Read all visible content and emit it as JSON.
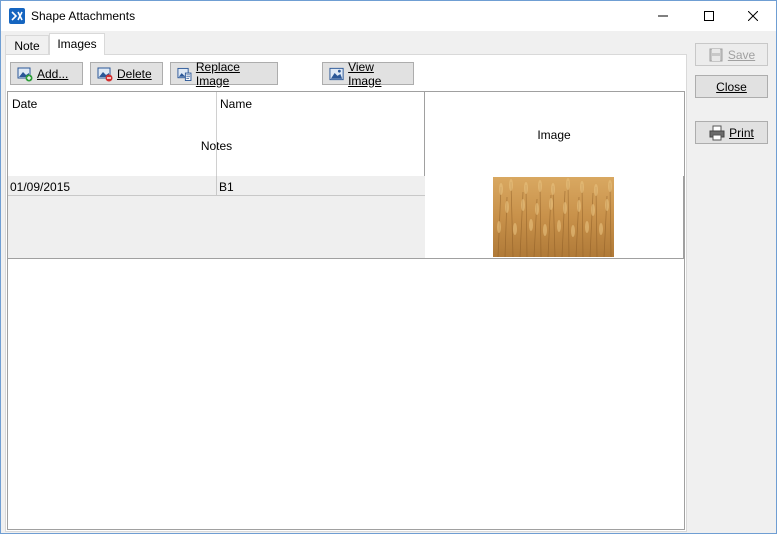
{
  "window": {
    "title": "Shape Attachments",
    "accent": "#1565c0"
  },
  "tabs": [
    {
      "label": "Note",
      "active": false
    },
    {
      "label": "Images",
      "active": true
    }
  ],
  "toolbar": {
    "add_label": "Add...",
    "delete_label": "Delete",
    "replace_label": "Replace Image",
    "view_label": "View Image"
  },
  "table": {
    "columns": {
      "date": "Date",
      "name": "Name",
      "notes": "Notes",
      "image": "Image"
    },
    "rows": [
      {
        "date": "01/09/2015",
        "name": "B1",
        "notes": "",
        "image": "wheat-field-thumbnail"
      }
    ]
  },
  "side_buttons": {
    "save_label": "Save",
    "close_label": "Close",
    "print_label": "Print"
  },
  "icons": [
    "app-icon",
    "minimize-icon",
    "maximize-icon",
    "close-icon",
    "add-image-icon",
    "delete-image-icon",
    "replace-image-icon",
    "view-image-icon",
    "save-icon",
    "print-icon"
  ]
}
